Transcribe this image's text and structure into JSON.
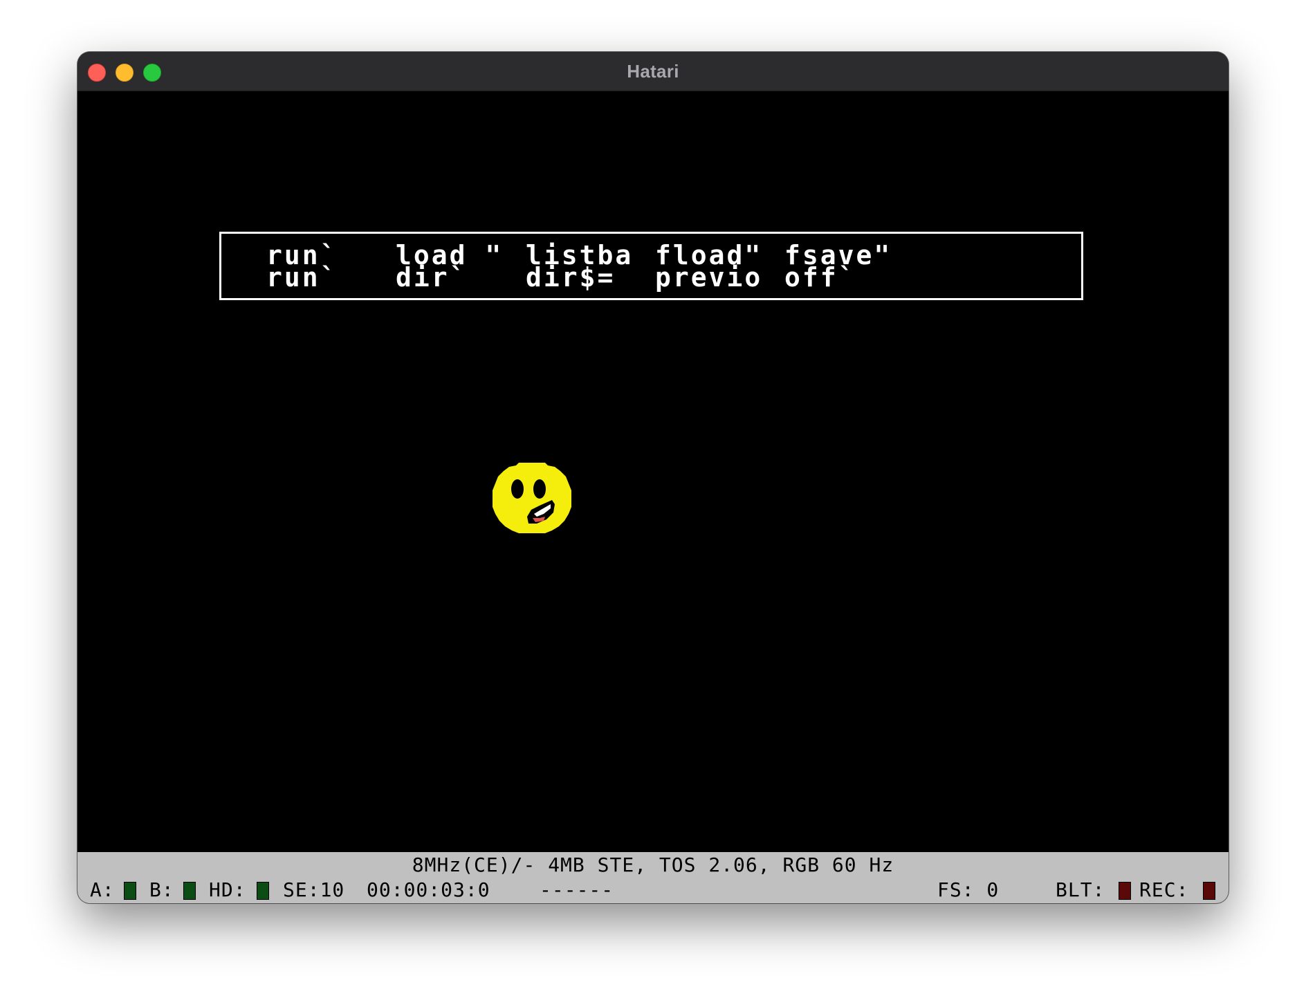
{
  "window": {
    "title": "Hatari"
  },
  "function_keys": {
    "row1": [
      "run`",
      "load \"",
      "listba",
      "fload\"",
      "fsave\""
    ],
    "row2": [
      "run`",
      "dir`",
      "dir$=",
      "previo",
      "off`"
    ]
  },
  "status": {
    "machine_info": "8MHz(CE)/- 4MB STE, TOS 2.06, RGB 60 Hz",
    "drive_a_label": "A:",
    "drive_b_label": "B:",
    "hd_label": "HD:",
    "se_label": "SE:10",
    "time": "00:00:03:0",
    "dashes": "------",
    "fs_label": "FS: 0",
    "blt_label": "BLT:",
    "rec_label": "REC:"
  },
  "colors": {
    "drive_led_off": "#0b4d14",
    "blt_led": "#5a0808",
    "rec_led": "#5a0808",
    "smiley_face": "#f5ee0d",
    "status_bg": "#c0c0c0"
  },
  "icons": {
    "sprite": "smiley-face-icon"
  }
}
